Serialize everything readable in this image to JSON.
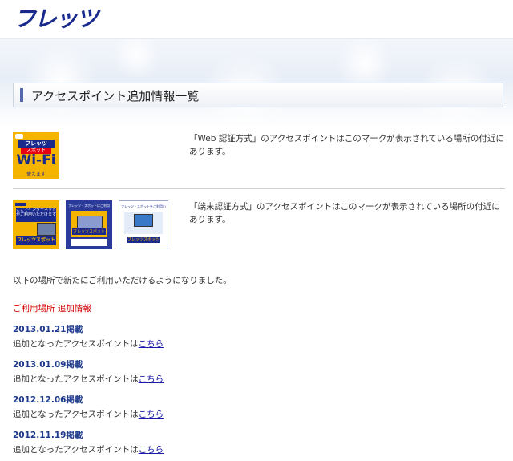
{
  "header": {
    "logo_text": "フレッツ",
    "page_title": "アクセスポイント追加情報一覧"
  },
  "web_auth": {
    "badge": {
      "small_text": "フレッツ",
      "small_text2": "スポット",
      "big_text": "Wi-Fi",
      "foot_text": "使えます"
    },
    "description": "「Web 認証方式」のアクセスポイントはこのマークが表示されている場所の付近にあります。"
  },
  "terminal_auth": {
    "badges": [
      {
        "top": "ここでインターネットがご利用いただけます",
        "brand": "フレッツスポット"
      },
      {
        "top": "フレッツ・スポットはご利用できます",
        "brand": "フレッツスポット"
      },
      {
        "top": "フレッツ・スポットをご利用いただけます",
        "brand": "フレッツスポット"
      }
    ],
    "description": "「端末認証方式」のアクセスポイントはこのマークが表示されている場所の付近にあります。"
  },
  "note": "以下の場所で新たにご利用いただけるようになりました。",
  "section_title": "ご利用場所 追加情報",
  "entries": [
    {
      "date": "2013.01.21掲載",
      "text": "追加となったアクセスポイントは",
      "link": "こちら"
    },
    {
      "date": "2013.01.09掲載",
      "text": "追加となったアクセスポイントは",
      "link": "こちら"
    },
    {
      "date": "2012.12.06掲載",
      "text": "追加となったアクセスポイントは",
      "link": "こちら"
    },
    {
      "date": "2012.11.19掲載",
      "text": "追加となったアクセスポイントは",
      "link": "こちら"
    }
  ],
  "colors": {
    "brand_navy": "#1a2a8c",
    "badge_yellow": "#f5b400",
    "link_blue": "#1a1aa6",
    "section_red": "#d40000",
    "date_navy": "#1e3a8a"
  }
}
